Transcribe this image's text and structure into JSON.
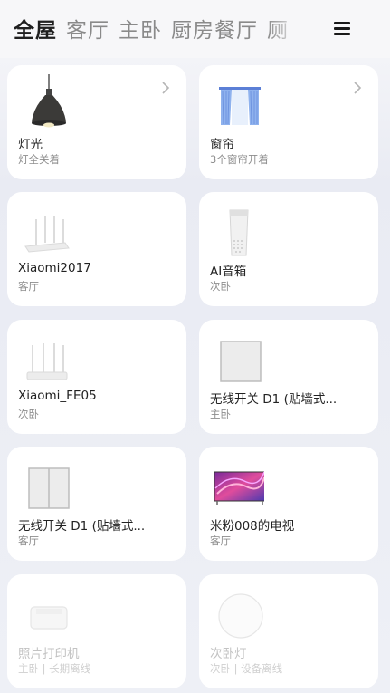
{
  "tabs": [
    {
      "label": "全屋",
      "active": true
    },
    {
      "label": "客厅",
      "active": false
    },
    {
      "label": "主卧",
      "active": false
    },
    {
      "label": "厨房餐厅",
      "active": false
    },
    {
      "label": "厕",
      "active": false
    }
  ],
  "devices": [
    {
      "name": "灯光",
      "status": "灯全关着",
      "icon": "pendant-lamp-icon",
      "chevron": true
    },
    {
      "name": "窗帘",
      "status": "3个窗帘开着",
      "icon": "curtain-icon",
      "chevron": true
    },
    {
      "name": "Xiaomi2017",
      "status": "客厅",
      "icon": "router-icon"
    },
    {
      "name": "AI音箱",
      "status": "次卧",
      "icon": "smart-speaker-icon"
    },
    {
      "name": "Xiaomi_FE05",
      "status": "次卧",
      "icon": "router-icon"
    },
    {
      "name": "无线开关 D1 (贴墙式...",
      "status": "主卧",
      "icon": "wall-switch-single-icon"
    },
    {
      "name": "无线开关 D1 (贴墙式...",
      "status": "客厅",
      "icon": "wall-switch-double-icon"
    },
    {
      "name": "米粉008的电视",
      "status": "客厅",
      "icon": "tv-icon"
    },
    {
      "name": "照片打印机",
      "status": "主卧 | 长期离线",
      "icon": "photo-printer-icon",
      "offline": true
    },
    {
      "name": "次卧灯",
      "status": "次卧 | 设备离线",
      "icon": "ceiling-light-icon",
      "offline": true
    }
  ],
  "colors": {
    "accent": "#202020",
    "card": "#ffffff",
    "muted": "#8d8d8d",
    "offline": "#c3c3c3"
  }
}
